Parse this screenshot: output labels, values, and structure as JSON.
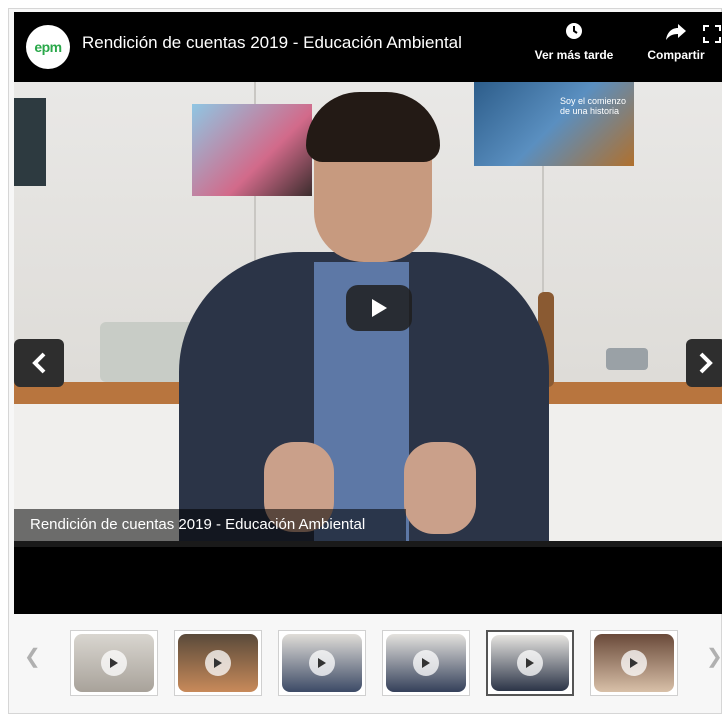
{
  "player": {
    "logo_text": "epm",
    "title": "Rendición de cuentas 2019 - Educación Ambiental",
    "watch_later_label": "Ver más tarde",
    "share_label": "Compartir",
    "caption": "Rendición de cuentas 2019 - Educación Ambiental",
    "poster_text": "Soy el comienzo de una historia"
  },
  "thumbnails": [
    {
      "name": "thumbnail-1",
      "active": false
    },
    {
      "name": "thumbnail-2",
      "active": false
    },
    {
      "name": "thumbnail-3",
      "active": false
    },
    {
      "name": "thumbnail-4",
      "active": false
    },
    {
      "name": "thumbnail-5",
      "active": true
    },
    {
      "name": "thumbnail-6",
      "active": false
    }
  ],
  "colors": {
    "brand_green": "#2aa84a",
    "player_bg": "#000000"
  }
}
